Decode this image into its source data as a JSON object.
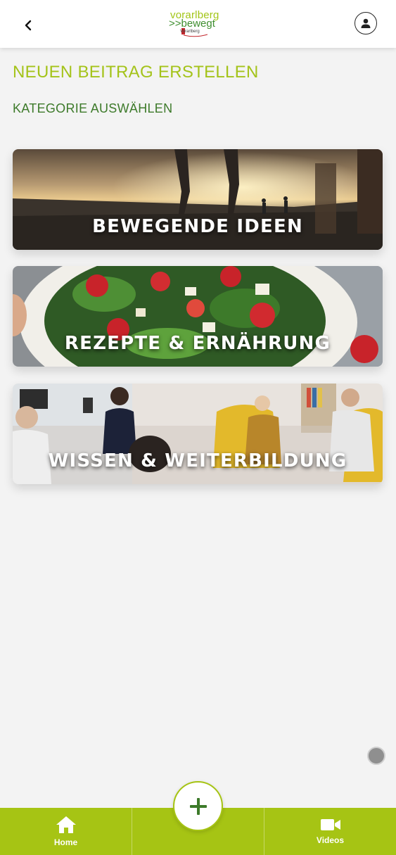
{
  "header": {
    "logo": {
      "top": "vorarlberg",
      "bottom": ">>bewegt",
      "sub": "Vorarlberg"
    }
  },
  "page": {
    "title": "NEUEN BEITRAG ERSTELLEN",
    "section_label": "KATEGORIE AUSWÄHLEN"
  },
  "categories": [
    {
      "label": "BEWEGENDE IDEEN"
    },
    {
      "label": "REZEPTE & ERNÄHRUNG"
    },
    {
      "label": "WISSEN & WEITERBILDUNG"
    }
  ],
  "bottom_nav": {
    "home_label": "Home",
    "videos_label": "Videos"
  },
  "colors": {
    "accent": "#a6c414",
    "title": "#a4c31a",
    "section": "#3d7a2a"
  },
  "icons": {
    "back": "chevron-left-icon",
    "profile": "user-icon",
    "home": "home-icon",
    "videos": "video-camera-icon",
    "add": "plus-icon"
  }
}
